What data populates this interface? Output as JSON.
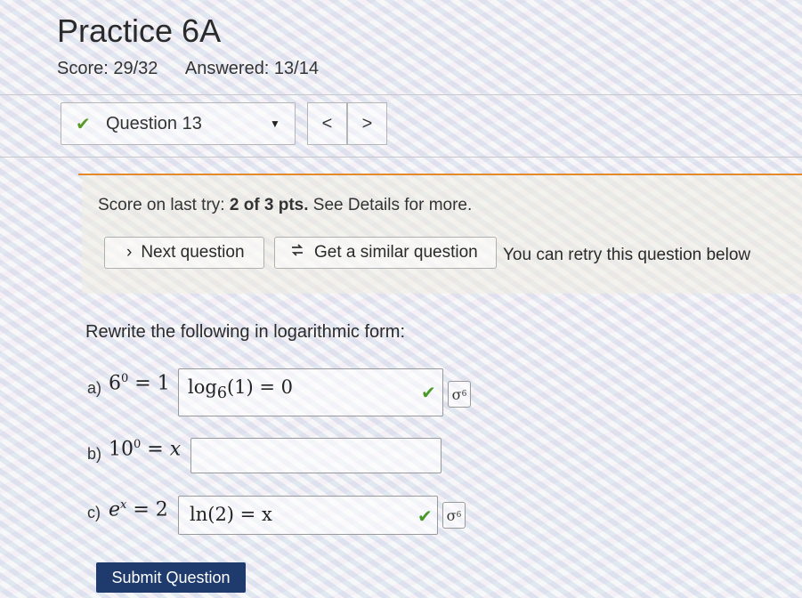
{
  "page": {
    "title": "Practice 6A",
    "score_text": "Score: 29/32",
    "answered_text": "Answered: 13/14"
  },
  "question_nav": {
    "selected": "Question 13",
    "prev_label": "<",
    "next_label": ">"
  },
  "feedback": {
    "prefix": "Score on last try: ",
    "score_bold": "2 of 3 pts.",
    "suffix": " See Details for more.",
    "next_question_label": "Next question",
    "similar_question_label": "Get a similar question",
    "retry_text": "You can retry this question below"
  },
  "question": {
    "prompt": "Rewrite the following in logarithmic form:",
    "parts": [
      {
        "label": "a)",
        "base": "6",
        "exp": "0",
        "rhs": "1",
        "answer_fn": "log",
        "answer_sub": "6",
        "answer_rest": "(1) = 0",
        "status": "correct"
      },
      {
        "label": "b)",
        "base": "10",
        "exp": "0",
        "rhs": "x",
        "answer": "",
        "status": "empty"
      },
      {
        "label": "c)",
        "base": "e",
        "exp": "x",
        "rhs": "2",
        "answer_fn": "ln",
        "answer_rest": "(2) = x",
        "status": "correct"
      }
    ]
  },
  "submit_label": "Submit Question",
  "icons": {
    "check": "check-icon",
    "caret": "caret-down-icon",
    "chevron": "chevron-right-icon",
    "refresh": "refresh-icon",
    "key": "key-icon"
  },
  "colors": {
    "accent_orange": "#e58a2a",
    "submit_bg": "#1f3b6e",
    "correct_green": "#4a9a2a"
  }
}
